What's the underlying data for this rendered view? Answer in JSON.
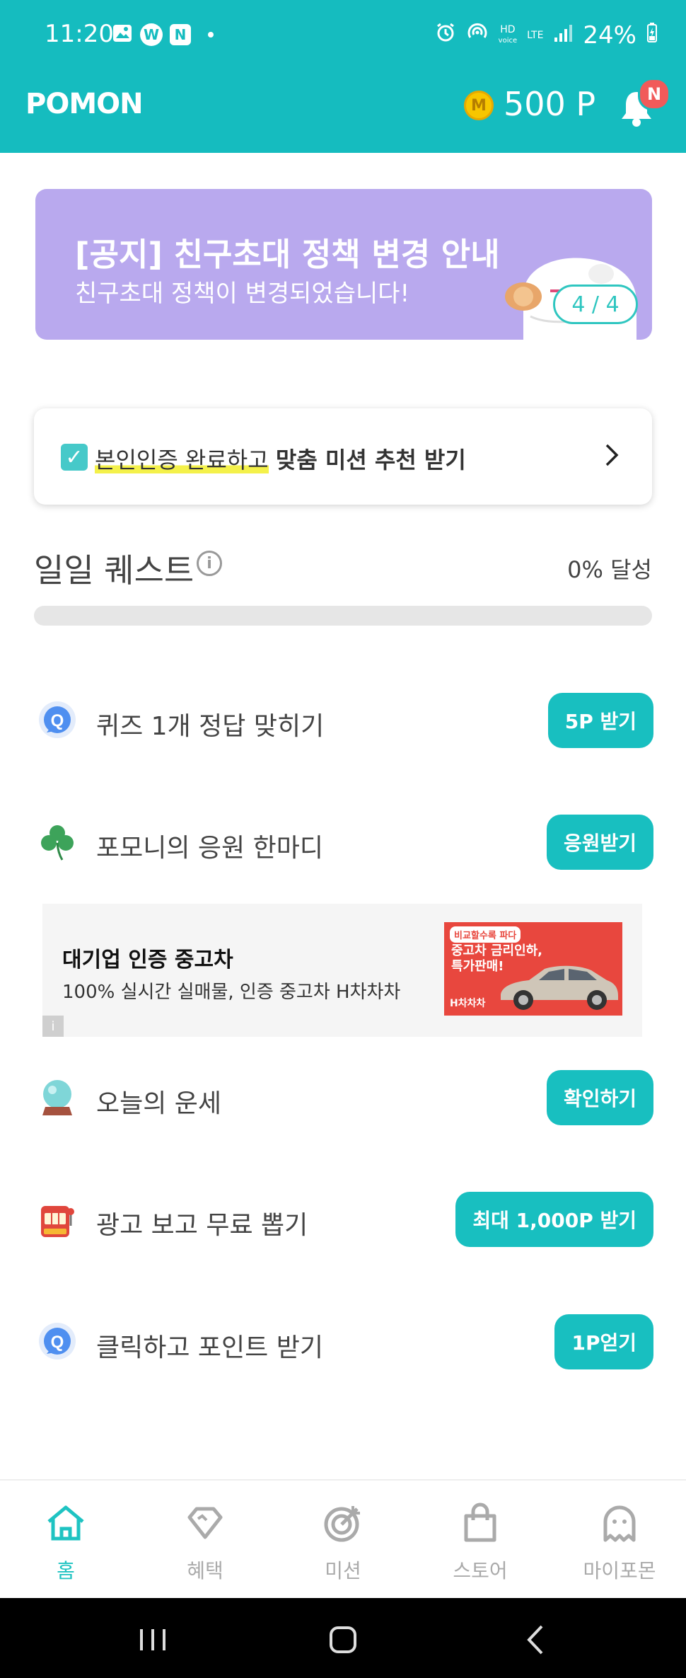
{
  "status_bar": {
    "time": "11:20",
    "app_icons": [
      "gallery-icon",
      "W",
      "N"
    ],
    "hd_label": "HD",
    "voice_label": "voice",
    "lte_label": "LTE",
    "battery": "24%"
  },
  "app_bar": {
    "logo": "POMON",
    "coin_symbol": "M",
    "points": "500 P",
    "notification_badge": "N"
  },
  "banner": {
    "title": "[공지] 친구초대 정책 변경 안내",
    "subtitle": "친구초대 정책이 변경되었습니다!",
    "counter": "4 / 4"
  },
  "verify": {
    "highlight_text": "본인인증 완료하고",
    "bold_text": "맞춤 미션 추천 받기"
  },
  "daily_quest": {
    "title": "일일 퀘스트",
    "info_symbol": "i",
    "progress_text": "0% 달성",
    "progress_value": 0
  },
  "quests": [
    {
      "icon": "quiz-q-icon",
      "label": "퀴즈 1개 정답 맞히기",
      "button": "5P 받기"
    },
    {
      "icon": "clover-icon",
      "label": "포모니의 응원 한마디",
      "button": "응원받기"
    },
    {
      "icon": "crystal-ball-icon",
      "label": "오늘의 운세",
      "button": "확인하기"
    },
    {
      "icon": "slot-machine-icon",
      "label": "광고 보고 무료 뽑기",
      "button": "최대 1,000P 받기"
    },
    {
      "icon": "quiz-q-icon",
      "label": "클릭하고 포인트 받기",
      "button": "1P얻기"
    }
  ],
  "ad": {
    "title": "대기업 인증 중고차",
    "description": "100% 실시간 실매물, 인증 중고차 H차차차",
    "info_symbol": "i",
    "image_tag": "비교할수록 파다",
    "image_copy_line1": "중고차 금리인하,",
    "image_copy_line2": "특가판매!",
    "image_brand": "H차차차"
  },
  "bottom_nav": [
    {
      "label": "홈",
      "icon": "home-icon",
      "active": true
    },
    {
      "label": "혜택",
      "icon": "diamond-icon",
      "active": false
    },
    {
      "label": "미션",
      "icon": "target-icon",
      "active": false
    },
    {
      "label": "스토어",
      "icon": "shopping-bag-icon",
      "active": false
    },
    {
      "label": "마이포몬",
      "icon": "ghost-icon",
      "active": false
    }
  ],
  "colors": {
    "primary": "#15bcbf",
    "banner_bg": "#b9a9ee",
    "badge": "#f15a5a",
    "highlight": "#f4f14a"
  }
}
